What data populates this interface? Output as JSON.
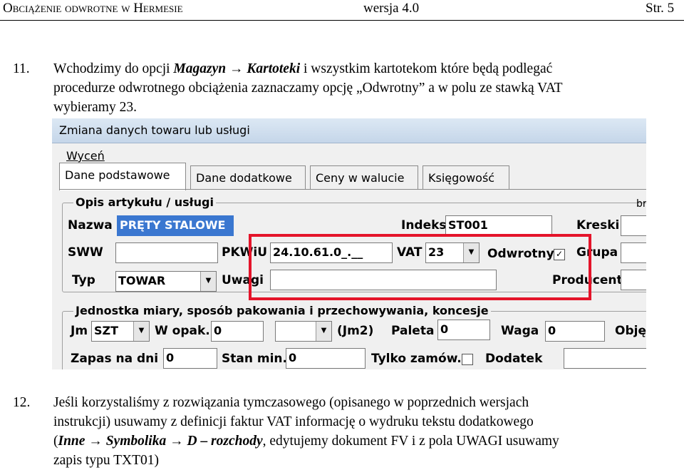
{
  "header": {
    "title": "Obciążenie odwrotne w Hermesie",
    "version": "wersja 4.0",
    "page": "Str. 5"
  },
  "step11": {
    "number": "11.",
    "t1": "Wchodzimy do opcji ",
    "magazyn": "Magazyn",
    "arrow": " → ",
    "kartoteki": "Kartoteki",
    "t2": " i wszystkim kartotekom które będą podlegać",
    "line2": "procedurze odwrotnego obciążenia zaznaczamy opcję „Odwrotny” a w polu ze stawką VAT",
    "line3": "wybieramy 23."
  },
  "window": {
    "title": "Zmiana danych towaru lub usługi",
    "menu": "Wyceń",
    "tabs": [
      "Dane podstawowe",
      "Dane dodatkowe",
      "Ceny w walucie",
      "Księgowość"
    ],
    "group1_title": "Opis artykułu / usługi",
    "group1_corner": "br",
    "nazwa_label": "Nazwa",
    "nazwa_value": "PRĘTY STALOWE",
    "indeks_label": "Indeks",
    "indeks_value": "ST001",
    "kreski_label": "Kreski",
    "sww_label": "SWW",
    "pkwiu_label": "PKWiU",
    "pkwiu_value": "24.10.61.0_.__",
    "vat_label": "VAT",
    "vat_value": "23",
    "odwrotny_label": "Odwrotny",
    "odwrotny_check": "✓",
    "grupa_label": "Grupa",
    "typ_label": "Typ",
    "typ_value": "TOWAR",
    "uwagi_label": "Uwagi",
    "producent_label": "Producent",
    "group2_title": "Jednostka miary, sposób pakowania i przechowywania, koncesje",
    "jm_label": "Jm",
    "jm_value": "SZT",
    "wopak_label": "W opak.",
    "wopak_value": "0",
    "jm2_label": "(Jm2)",
    "paleta_label": "Paleta",
    "paleta_value": "0",
    "waga_label": "Waga",
    "waga_value": "0",
    "objetosc_label": "Objęt",
    "zapas_label": "Zapas na dni",
    "zapas_value": "0",
    "stanmin_label": "Stan min.",
    "stanmin_value": "0",
    "tylko_label": "Tylko zamów.",
    "dodatek_label": "Dodatek"
  },
  "step12": {
    "number": "12.",
    "line1": "Jeśli korzystaliśmy z rozwiązania tymczasowego (opisanego w poprzednich wersjach",
    "line2": "instrukcji) usuwamy z definicji faktur VAT informację o wydruku tekstu dodatkowego",
    "p_inne": "Inne",
    "p_arrow": " → ",
    "p_symbolika": "Symbolika",
    "p_arrow2": " → ",
    "p_d": "D",
    "p_dash": " – ",
    "p_rozchody": "rozchody",
    "p_rest": ", edytujemy dokument FV i z pola UWAGI usuwamy",
    "line4": "zapis typu TXT01)"
  },
  "colors": {
    "highlight_box": "#e4142a",
    "selection": "#3a77d0"
  }
}
